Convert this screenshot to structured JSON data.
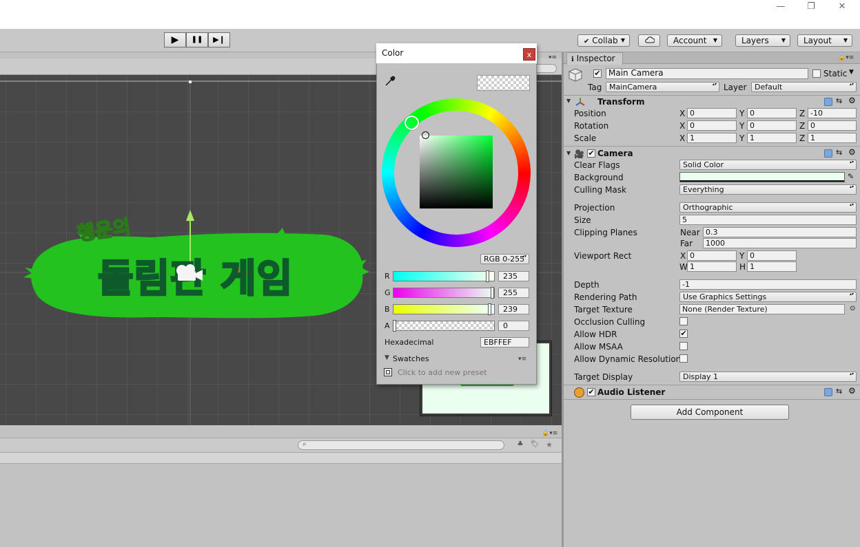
{
  "window": {
    "minimize_glyph": "—",
    "maximize_glyph": "❐",
    "close_glyph": "✕"
  },
  "toolbar": {
    "play_glyph": "▶",
    "pause_glyph": "❚❚",
    "step_glyph": "▶❙",
    "collab_label": "Collab",
    "account_label": "Account",
    "layers_label": "Layers",
    "layout_label": "Layout"
  },
  "scene": {
    "title_small": "행운의",
    "title_big": "돌림판 게임"
  },
  "color_picker": {
    "title": "Color",
    "close_label": "x",
    "mode_label": "RGB 0-255",
    "channels": [
      {
        "label": "R",
        "value": "235"
      },
      {
        "label": "G",
        "value": "255"
      },
      {
        "label": "B",
        "value": "239"
      },
      {
        "label": "A",
        "value": "0"
      }
    ],
    "hex_label": "Hexadecimal",
    "hex_value": "EBFFEF",
    "swatches_label": "Swatches",
    "preset_hint": "Click to add new preset"
  },
  "inspector": {
    "tab_label": "Inspector",
    "object_name": "Main Camera",
    "static_label": "Static",
    "tag_label": "Tag",
    "tag_value": "MainCamera",
    "layer_label": "Layer",
    "layer_value": "Default",
    "transform": {
      "title": "Transform",
      "rows": [
        {
          "label": "Position",
          "x": "0",
          "y": "0",
          "z": "-10"
        },
        {
          "label": "Rotation",
          "x": "0",
          "y": "0",
          "z": "0"
        },
        {
          "label": "Scale",
          "x": "1",
          "y": "1",
          "z": "1"
        }
      ]
    },
    "camera": {
      "title": "Camera",
      "clear_flags_label": "Clear Flags",
      "clear_flags_value": "Solid Color",
      "background_label": "Background",
      "background_color": "#EBFFEF",
      "culling_mask_label": "Culling Mask",
      "culling_mask_value": "Everything",
      "projection_label": "Projection",
      "projection_value": "Orthographic",
      "size_label": "Size",
      "size_value": "5",
      "clipping_label": "Clipping Planes",
      "near_label": "Near",
      "near_value": "0.3",
      "far_label": "Far",
      "far_value": "1000",
      "viewport_label": "Viewport Rect",
      "vp_x": "0",
      "vp_y": "0",
      "vp_w": "1",
      "vp_h": "1",
      "depth_label": "Depth",
      "depth_value": "-1",
      "rendering_path_label": "Rendering Path",
      "rendering_path_value": "Use Graphics Settings",
      "target_texture_label": "Target Texture",
      "target_texture_value": "None (Render Texture)",
      "occlusion_label": "Occlusion Culling",
      "occlusion_checked": false,
      "hdr_label": "Allow HDR",
      "hdr_checked": true,
      "msaa_label": "Allow MSAA",
      "msaa_checked": false,
      "dynres_label": "Allow Dynamic Resolution",
      "dynres_checked": false,
      "target_display_label": "Target Display",
      "target_display_value": "Display 1"
    },
    "audio_listener_title": "Audio Listener",
    "add_component_label": "Add Component",
    "axis_x": "X",
    "axis_y": "Y",
    "axis_z": "Z",
    "axis_w": "W",
    "axis_h": "H"
  },
  "colors": {
    "accent_green": "#2fc42f",
    "background_color": "#EBFFEF",
    "close_red": "#c8403a"
  }
}
